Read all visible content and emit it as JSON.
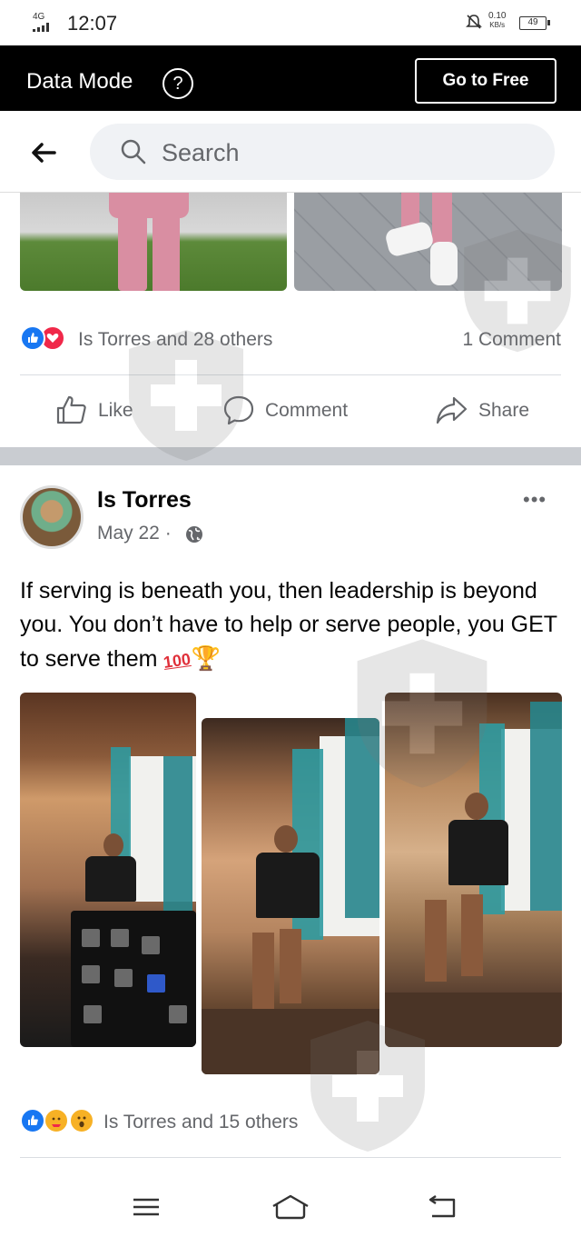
{
  "status_bar": {
    "network": "4G",
    "time": "12:07",
    "speed_value": "0.10",
    "speed_unit": "KB/s",
    "battery": "49"
  },
  "data_bar": {
    "title": "Data Mode",
    "help": "?",
    "go_free_label": "Go to Free"
  },
  "search": {
    "placeholder": "Search"
  },
  "prev_post": {
    "reaction_text": "Is Torres and 28 others",
    "comment_count": "1 Comment",
    "actions": {
      "like": "Like",
      "comment": "Comment",
      "share": "Share"
    }
  },
  "post": {
    "author": "Is Torres",
    "date": "May 22 ·",
    "more": "•••",
    "text": "If serving is beneath you, then leadership is beyond you. You don’t have to help or serve people, you GET to serve them",
    "emoji_100": "100",
    "emoji_trophy": "🏆",
    "reaction_text": "Is Torres and 15 others"
  },
  "colors": {
    "like_blue": "#1877f2",
    "love_red": "#f02849",
    "haha_yellow": "#f7b125",
    "separator": "#c9ccd1"
  }
}
